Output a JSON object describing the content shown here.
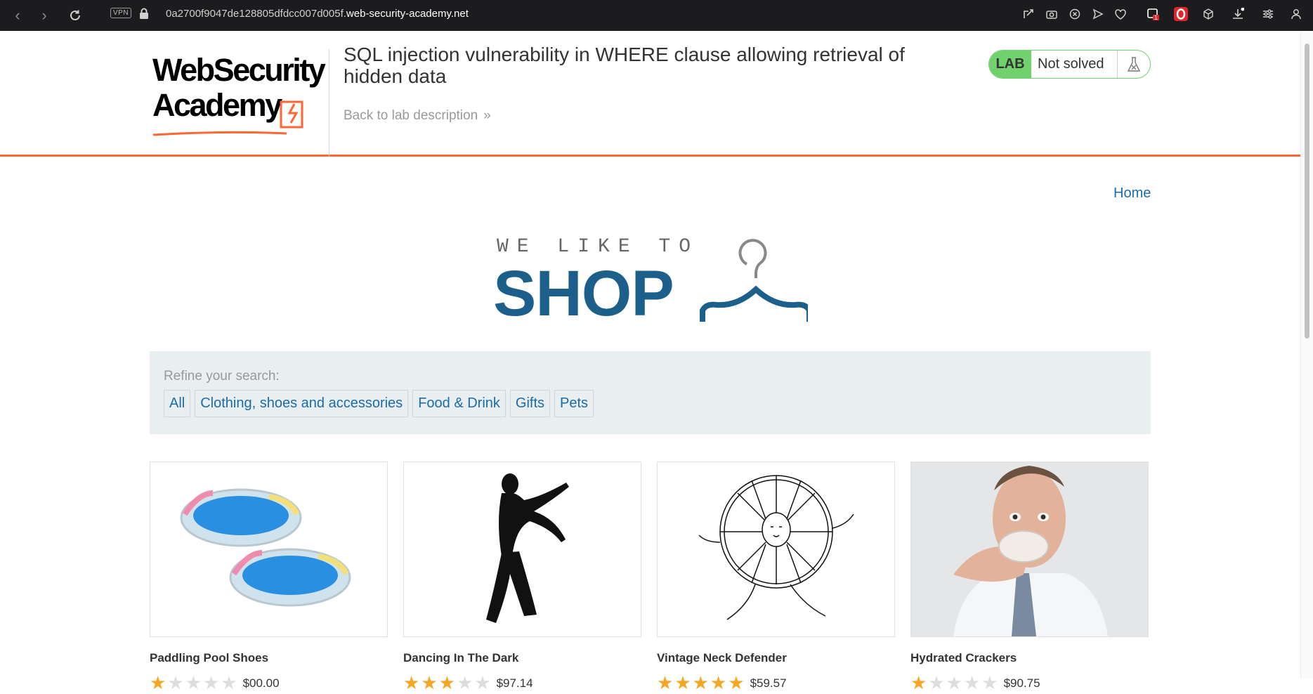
{
  "browser": {
    "url_prefix": "0a2700f9047de128805dfdcc007d005f.",
    "url_domain": "web-security-academy.net",
    "vpn_label": "VPN",
    "notification_count": "1"
  },
  "header": {
    "logo_line1": "WebSecurity",
    "logo_line2": "Academy",
    "lab_title": "SQL injection vulnerability in WHERE clause allowing retrieval of hidden data",
    "back_link": "Back to lab description",
    "lab_label": "LAB",
    "lab_status": "Not solved"
  },
  "nav": {
    "home": "Home"
  },
  "banner": {
    "small": "WE LIKE TO",
    "big": "SHOP"
  },
  "search": {
    "label": "Refine your search:",
    "filters": [
      "All",
      "Clothing, shoes and accessories",
      "Food & Drink",
      "Gifts",
      "Pets"
    ]
  },
  "products": [
    {
      "name": "Paddling Pool Shoes",
      "rating": 1,
      "price": "$00.00"
    },
    {
      "name": "Dancing In The Dark",
      "rating": 3,
      "price": "$97.14"
    },
    {
      "name": "Vintage Neck Defender",
      "rating": 5,
      "price": "$59.57"
    },
    {
      "name": "Hydrated Crackers",
      "rating": 1,
      "price": "$90.75"
    }
  ],
  "colors": {
    "accent_orange": "#ff6633",
    "link_blue": "#1b6ca8",
    "lab_green": "#70d16d",
    "shop_blue": "#1b5f8a",
    "star_gold": "#f5a623"
  }
}
